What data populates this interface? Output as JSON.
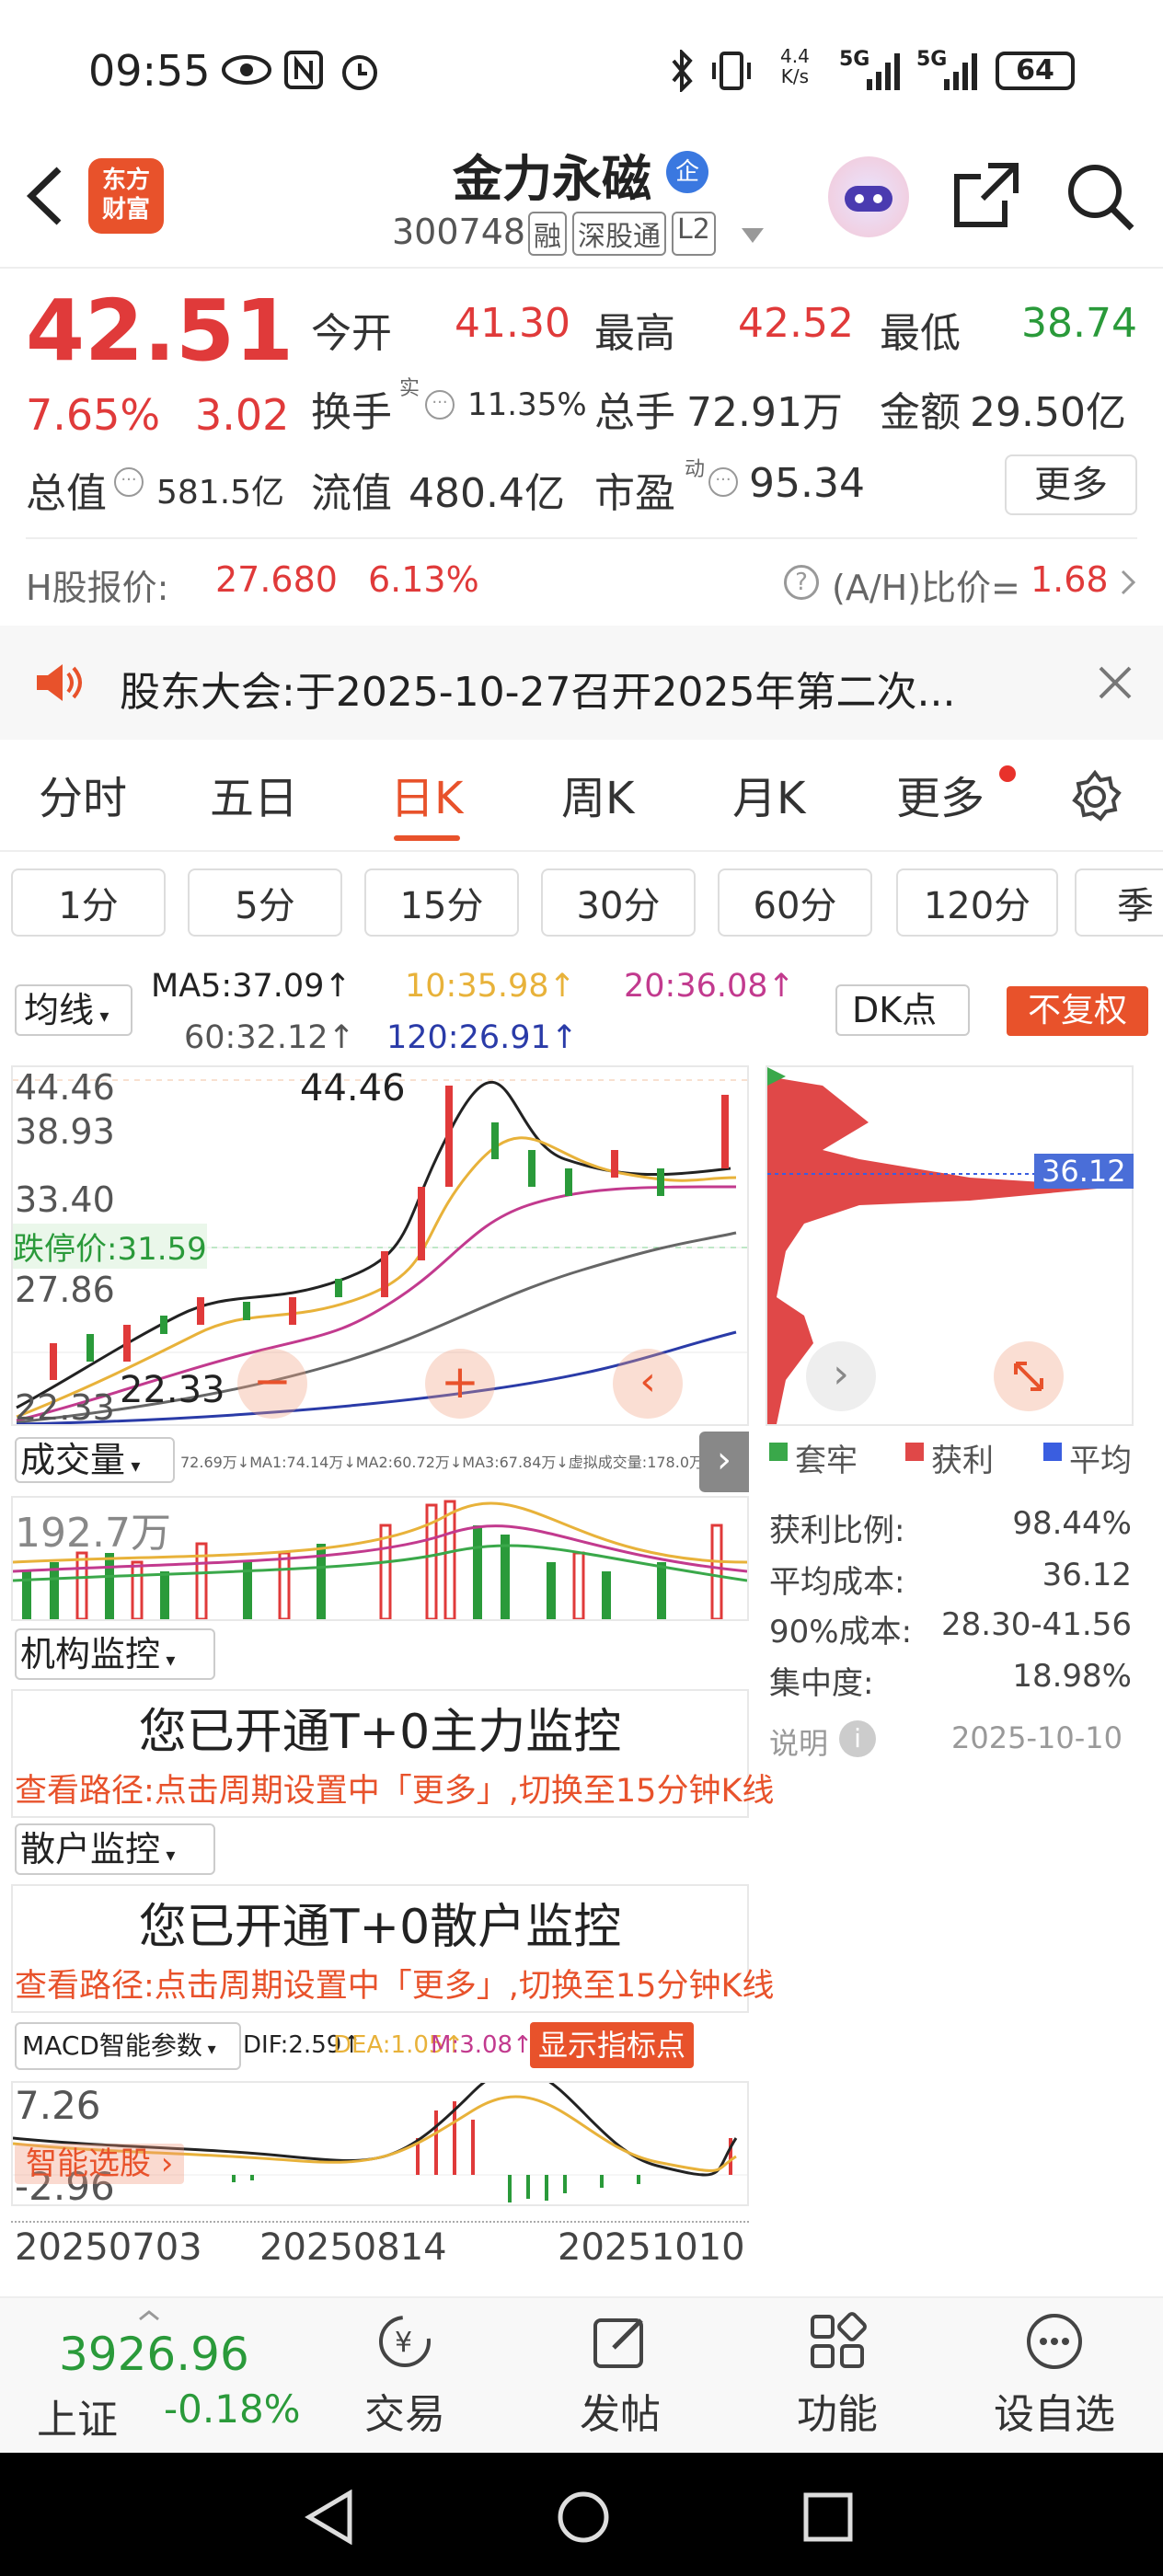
{
  "status": {
    "time": "09:55",
    "net_speed_top": "4.4",
    "net_speed_unit": "K/s",
    "sig1": "5G",
    "sig2": "5G",
    "battery": "64"
  },
  "header": {
    "stock_name": "金力永磁",
    "badge": "企",
    "code": "300748",
    "tags": [
      "融",
      "深股通",
      "L2"
    ],
    "logo_line1": "东方",
    "logo_line2": "财富"
  },
  "quote": {
    "price": "42.51",
    "pct": "7.65%",
    "change": "3.02",
    "open_label": "今开",
    "open": "41.30",
    "high_label": "最高",
    "high": "42.52",
    "low_label": "最低",
    "low": "38.74",
    "turnover_label": "换手",
    "turnover_sup": "实",
    "turnover": "11.35%",
    "vol_label": "总手",
    "vol": "72.91万",
    "amt_label": "金额",
    "amt": "29.50亿",
    "mcap_label": "总值",
    "mcap": "581.5亿",
    "float_label": "流值",
    "float": "480.4亿",
    "pe_label": "市盈",
    "pe_sup": "动",
    "pe": "95.34",
    "more": "更多"
  },
  "hshare": {
    "label": "H股报价:",
    "price": "27.680",
    "pct": "6.13%",
    "ah_label": "(A/H)比价=",
    "ah": "1.68"
  },
  "notice": {
    "text": "股东大会:于2025-10-27召开2025年第二次..."
  },
  "tabs": [
    "分时",
    "五日",
    "日K",
    "周K",
    "月K",
    "更多"
  ],
  "periods": [
    "1分",
    "5分",
    "15分",
    "30分",
    "60分",
    "120分",
    "季"
  ],
  "ma": {
    "sel": "均线",
    "ma5": "MA5:37.09↑",
    "ma10": "10:35.98↑",
    "ma20": "20:36.08↑",
    "ma60": "60:32.12↑",
    "ma120": "120:26.91↑",
    "dk": "DK点",
    "fq": "不复权"
  },
  "kchart": {
    "y_labels": [
      "44.46",
      "38.93",
      "33.40",
      "27.86",
      "22.33"
    ],
    "high_tag": "44.46",
    "low_tag": "22.33",
    "limit_label": "跌停价:31.59",
    "cost_tag": "36.12"
  },
  "volume": {
    "sel": "成交量",
    "info": "72.69万↓MA1:74.14万↓MA2:60.72万↓MA3:67.84万↓虚拟成交量:178.0万",
    "ylabel": "192.7万"
  },
  "chip": {
    "legend": [
      "套牢",
      "获利",
      "平均"
    ],
    "rows": [
      [
        "获利比例:",
        "98.44%"
      ],
      [
        "平均成本:",
        "36.12"
      ],
      [
        "90%成本:",
        "28.30-41.56"
      ],
      [
        "集中度:",
        "18.98%"
      ]
    ],
    "note": "说明",
    "date": "2025-10-10"
  },
  "inst": {
    "sel": "机构监控",
    "title": "您已开通T+0主力监控",
    "path": "查看路径:点击周期设置中「更多」,切换至15分钟K线"
  },
  "retail": {
    "sel": "散户监控",
    "title": "您已开通T+0散户监控",
    "path": "查看路径:点击周期设置中「更多」,切换至15分钟K线"
  },
  "macd": {
    "sel": "MACD智能参数",
    "dif": "DIF:2.59↑",
    "dea": "DEA:1.05↑",
    "m": "M:3.08↑",
    "btn": "显示指标点",
    "y_top": "7.26",
    "y_bot": "-2.96",
    "smart": "智能选股"
  },
  "dates": [
    "20250703",
    "20250814",
    "20251010"
  ],
  "footer": {
    "index_value": "3926.96",
    "index_name": "上证",
    "index_pct": "-0.18%",
    "nav": [
      "交易",
      "发帖",
      "功能",
      "设自选"
    ]
  }
}
